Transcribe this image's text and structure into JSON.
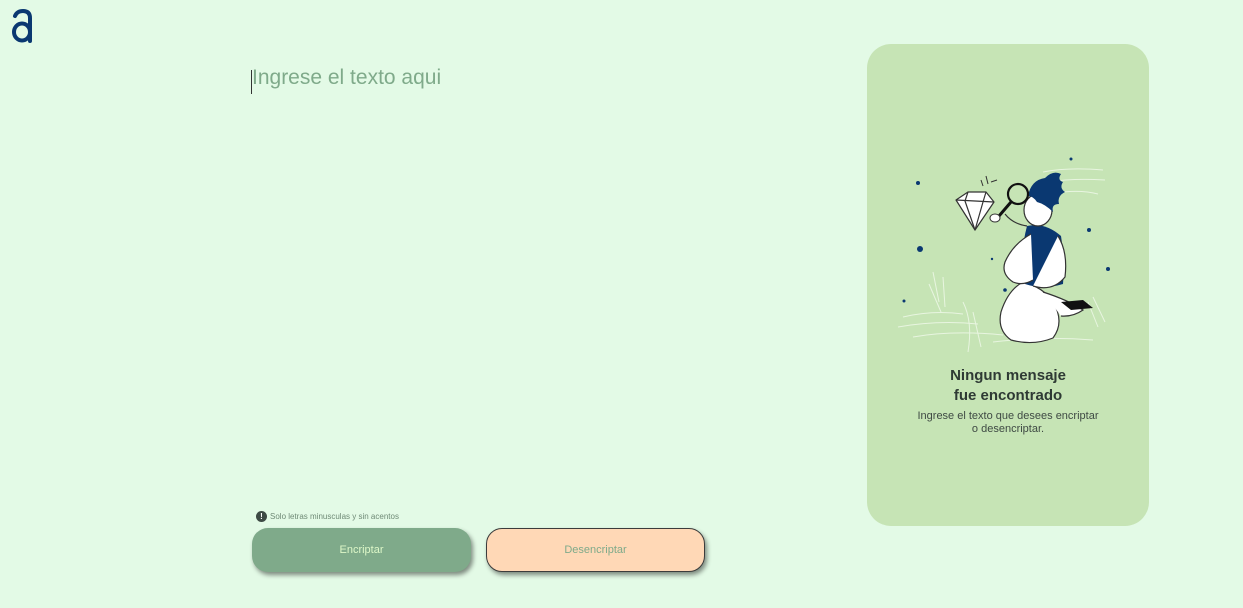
{
  "brand": {
    "logo_letter": "a",
    "logo_color": "#0A3871"
  },
  "input": {
    "placeholder": "Ingrese el texto aqui",
    "value": ""
  },
  "hint": {
    "icon": "exclamation-circle-icon",
    "icon_glyph": "!",
    "text": "Solo letras minusculas y sin acentos"
  },
  "buttons": {
    "encrypt_label": "Encriptar",
    "decrypt_label": "Desencriptar"
  },
  "result": {
    "title_line1": "Ningun mensaje",
    "title_line2": "fue encontrado",
    "desc_line1": "Ingrese el texto que desees encriptar",
    "desc_line2": "o desencriptar.",
    "illustration": "person-with-magnifying-glass-and-diamond"
  },
  "colors": {
    "background": "#E3FAE6",
    "panel": "#C6E4B5",
    "primary_button": "#7FAA8A",
    "secondary_button": "#FFD8B6",
    "accent": "#0A3871"
  }
}
